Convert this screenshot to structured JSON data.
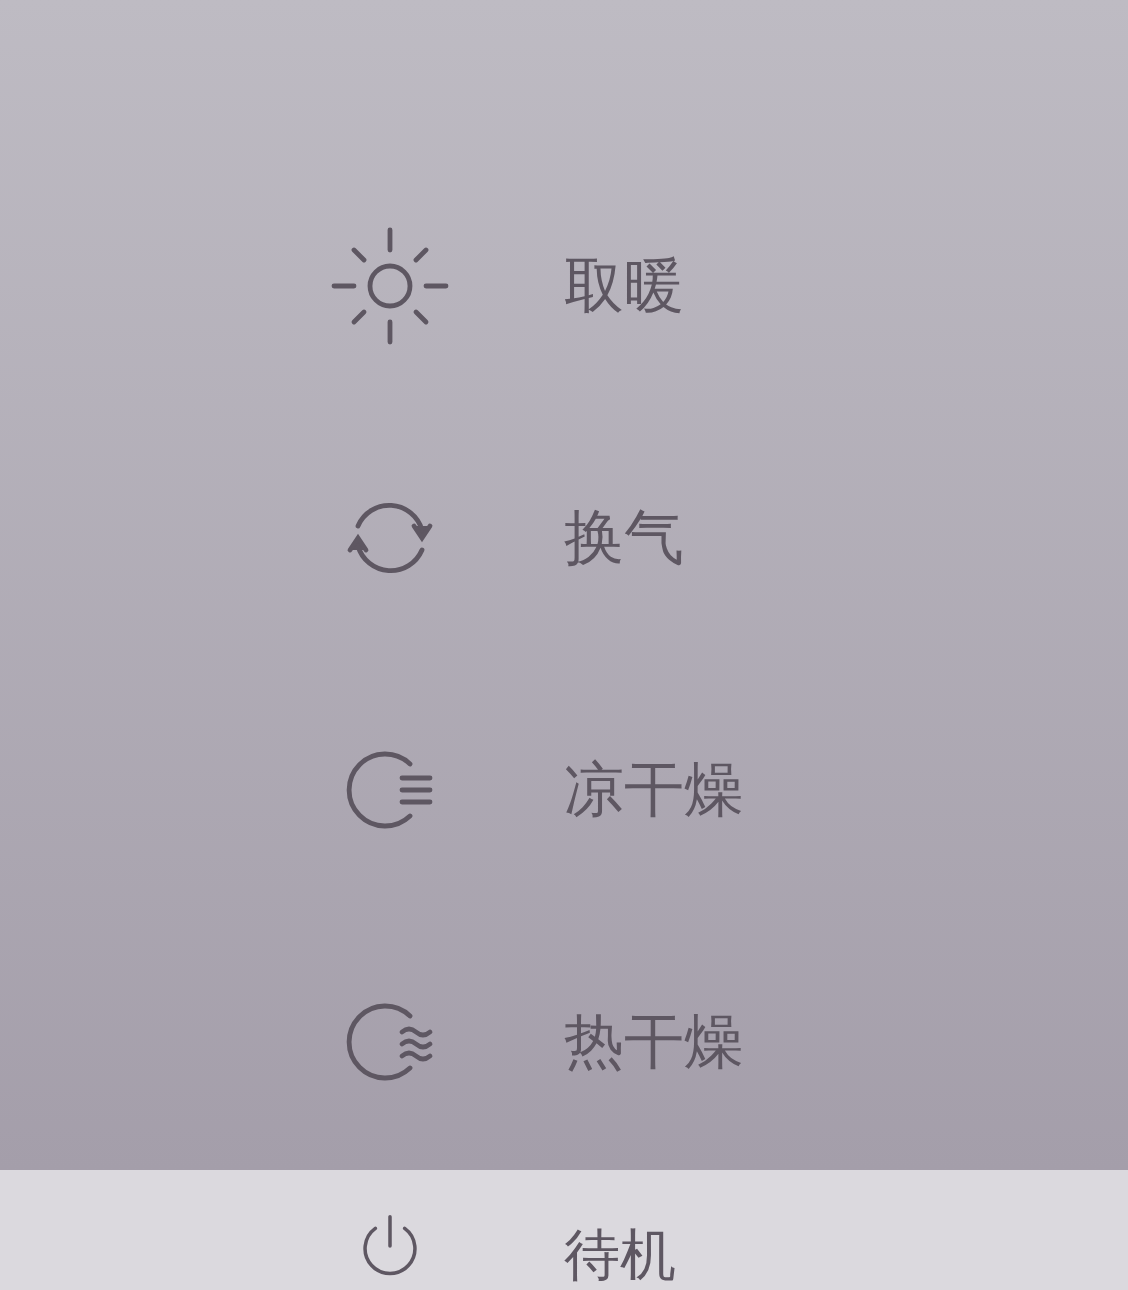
{
  "modes": [
    {
      "kind": "sun",
      "label": "取暖"
    },
    {
      "kind": "cycle",
      "label": "换气"
    },
    {
      "kind": "cool-dry",
      "label": "凉干燥"
    },
    {
      "kind": "hot-dry",
      "label": "热干燥"
    }
  ],
  "standby": {
    "kind": "power",
    "label": "待机"
  }
}
